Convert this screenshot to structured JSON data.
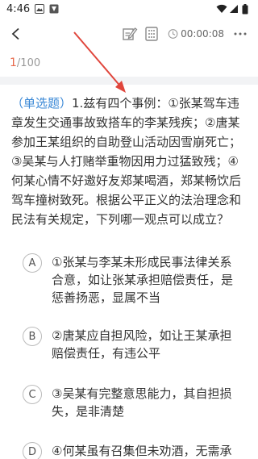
{
  "status_bar": {
    "time": "4:46"
  },
  "toolbar": {
    "timer": "00:00:08"
  },
  "progress": {
    "current": "1",
    "total": "/100"
  },
  "question": {
    "type_label": "（单选题）",
    "text": "1.兹有四个事例：①张某驾车违章发生交通事故致搭车的李某残疾；②唐某参加王某组织的自助登山活动因雪崩死亡；③吴某与人打赌举重物因用力过猛致残；④何某心情不好邀好友郑某喝酒，郑某畅饮后驾车撞树致死。根据公平正义的法治理念和民法有关规定，下列哪一观点可以成立？"
  },
  "options": [
    {
      "letter": "A",
      "text": "①张某与李某未形成民事法律关系合意，如让张某承担赔偿责任，是惩善扬恶，显属不当"
    },
    {
      "letter": "B",
      "text": "②唐某应自担风险，如让王某承担赔偿责任，有违公平"
    },
    {
      "letter": "C",
      "text": "③吴某有完整意思能力，其自担损失，是非清楚"
    },
    {
      "letter": "D",
      "text": "④何某虽有召集但未劝酒，无需承担"
    }
  ],
  "colors": {
    "accent": "#e8684a",
    "type_label": "#3a88d6",
    "arrow": "#e0463c"
  }
}
